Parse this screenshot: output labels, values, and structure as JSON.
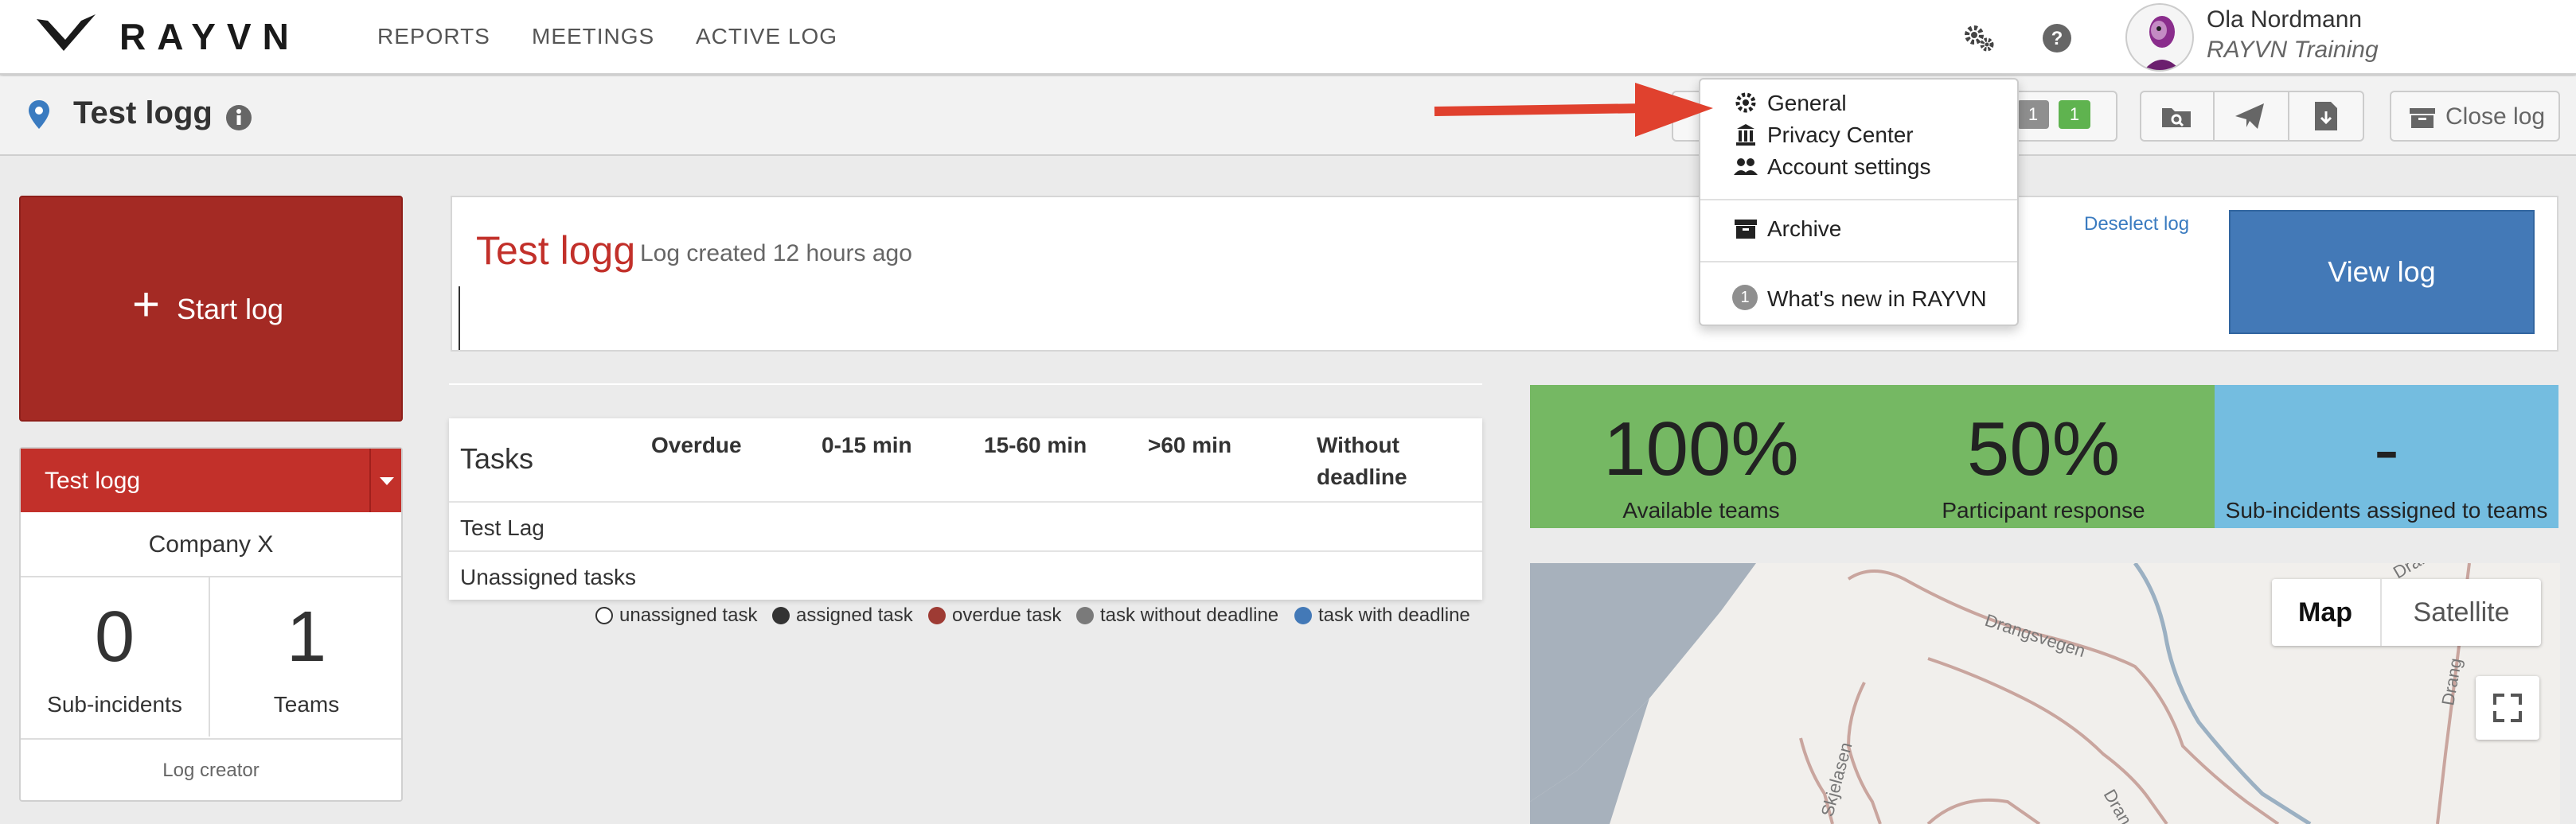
{
  "app": {
    "logo_text": "RAYVN",
    "nav": [
      "REPORTS",
      "MEETINGS",
      "ACTIVE LOG"
    ],
    "user": {
      "name": "Ola Nordmann",
      "org": "RAYVN Training"
    },
    "icons": [
      "settings-icon",
      "help-icon"
    ]
  },
  "header": {
    "title": "Test logg",
    "badges": [
      "1",
      "1"
    ],
    "close_log": "Close log"
  },
  "left": {
    "start_log": "Start log",
    "plus": "+",
    "log_name": "Test logg",
    "company": "Company X",
    "stats": [
      {
        "value": "0",
        "label": "Sub-incidents"
      },
      {
        "value": "1",
        "label": "Teams"
      }
    ],
    "creator": "Log creator"
  },
  "log": {
    "title": "Test logg",
    "subtitle": "Log created 12 hours ago",
    "deselect": "Deselect log",
    "view": "View log"
  },
  "tasks": {
    "title": "Tasks",
    "columns": [
      "Overdue",
      "0-15 min",
      "15-60 min",
      ">60 min",
      "Without",
      "deadline"
    ],
    "rows": [
      "Test Lag",
      "Unassigned tasks"
    ],
    "legend": [
      {
        "label": "unassigned task",
        "color": "#ffffff"
      },
      {
        "label": "assigned task",
        "color": "#333333"
      },
      {
        "label": "overdue task",
        "color": "#9e3b34"
      },
      {
        "label": "task without deadline",
        "color": "#7a7a7a"
      },
      {
        "label": "task with deadline",
        "color": "#4379b7"
      }
    ]
  },
  "kpis": [
    {
      "value": "100%",
      "label": "Available teams",
      "color": "#75b863"
    },
    {
      "value": "50%",
      "label": "Participant response",
      "color": "#75b863"
    },
    {
      "value": "-",
      "label": "Sub-incidents assigned to teams",
      "color": "#74bde0"
    }
  ],
  "map": {
    "buttons": [
      "Map",
      "Satellite"
    ],
    "road_labels": [
      "Drangsvegen",
      "Skjelasen",
      "Drang",
      "Dran",
      "Drang"
    ]
  },
  "menu": {
    "items": [
      "General",
      "Privacy Center",
      "Account settings"
    ],
    "archive": "Archive",
    "whats_new": "What's new in RAYVN",
    "whats_new_count": "1"
  }
}
